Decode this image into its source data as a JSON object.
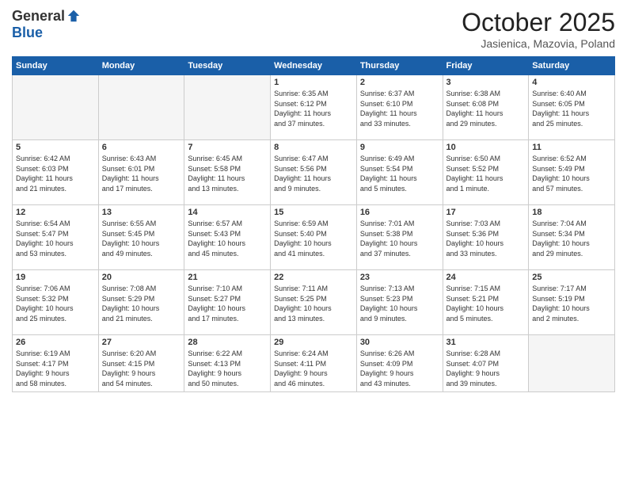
{
  "logo": {
    "general": "General",
    "blue": "Blue"
  },
  "header": {
    "month": "October 2025",
    "location": "Jasienica, Mazovia, Poland"
  },
  "weekdays": [
    "Sunday",
    "Monday",
    "Tuesday",
    "Wednesday",
    "Thursday",
    "Friday",
    "Saturday"
  ],
  "weeks": [
    [
      {
        "day": "",
        "info": ""
      },
      {
        "day": "",
        "info": ""
      },
      {
        "day": "",
        "info": ""
      },
      {
        "day": "1",
        "info": "Sunrise: 6:35 AM\nSunset: 6:12 PM\nDaylight: 11 hours\nand 37 minutes."
      },
      {
        "day": "2",
        "info": "Sunrise: 6:37 AM\nSunset: 6:10 PM\nDaylight: 11 hours\nand 33 minutes."
      },
      {
        "day": "3",
        "info": "Sunrise: 6:38 AM\nSunset: 6:08 PM\nDaylight: 11 hours\nand 29 minutes."
      },
      {
        "day": "4",
        "info": "Sunrise: 6:40 AM\nSunset: 6:05 PM\nDaylight: 11 hours\nand 25 minutes."
      }
    ],
    [
      {
        "day": "5",
        "info": "Sunrise: 6:42 AM\nSunset: 6:03 PM\nDaylight: 11 hours\nand 21 minutes."
      },
      {
        "day": "6",
        "info": "Sunrise: 6:43 AM\nSunset: 6:01 PM\nDaylight: 11 hours\nand 17 minutes."
      },
      {
        "day": "7",
        "info": "Sunrise: 6:45 AM\nSunset: 5:58 PM\nDaylight: 11 hours\nand 13 minutes."
      },
      {
        "day": "8",
        "info": "Sunrise: 6:47 AM\nSunset: 5:56 PM\nDaylight: 11 hours\nand 9 minutes."
      },
      {
        "day": "9",
        "info": "Sunrise: 6:49 AM\nSunset: 5:54 PM\nDaylight: 11 hours\nand 5 minutes."
      },
      {
        "day": "10",
        "info": "Sunrise: 6:50 AM\nSunset: 5:52 PM\nDaylight: 11 hours\nand 1 minute."
      },
      {
        "day": "11",
        "info": "Sunrise: 6:52 AM\nSunset: 5:49 PM\nDaylight: 10 hours\nand 57 minutes."
      }
    ],
    [
      {
        "day": "12",
        "info": "Sunrise: 6:54 AM\nSunset: 5:47 PM\nDaylight: 10 hours\nand 53 minutes."
      },
      {
        "day": "13",
        "info": "Sunrise: 6:55 AM\nSunset: 5:45 PM\nDaylight: 10 hours\nand 49 minutes."
      },
      {
        "day": "14",
        "info": "Sunrise: 6:57 AM\nSunset: 5:43 PM\nDaylight: 10 hours\nand 45 minutes."
      },
      {
        "day": "15",
        "info": "Sunrise: 6:59 AM\nSunset: 5:40 PM\nDaylight: 10 hours\nand 41 minutes."
      },
      {
        "day": "16",
        "info": "Sunrise: 7:01 AM\nSunset: 5:38 PM\nDaylight: 10 hours\nand 37 minutes."
      },
      {
        "day": "17",
        "info": "Sunrise: 7:03 AM\nSunset: 5:36 PM\nDaylight: 10 hours\nand 33 minutes."
      },
      {
        "day": "18",
        "info": "Sunrise: 7:04 AM\nSunset: 5:34 PM\nDaylight: 10 hours\nand 29 minutes."
      }
    ],
    [
      {
        "day": "19",
        "info": "Sunrise: 7:06 AM\nSunset: 5:32 PM\nDaylight: 10 hours\nand 25 minutes."
      },
      {
        "day": "20",
        "info": "Sunrise: 7:08 AM\nSunset: 5:29 PM\nDaylight: 10 hours\nand 21 minutes."
      },
      {
        "day": "21",
        "info": "Sunrise: 7:10 AM\nSunset: 5:27 PM\nDaylight: 10 hours\nand 17 minutes."
      },
      {
        "day": "22",
        "info": "Sunrise: 7:11 AM\nSunset: 5:25 PM\nDaylight: 10 hours\nand 13 minutes."
      },
      {
        "day": "23",
        "info": "Sunrise: 7:13 AM\nSunset: 5:23 PM\nDaylight: 10 hours\nand 9 minutes."
      },
      {
        "day": "24",
        "info": "Sunrise: 7:15 AM\nSunset: 5:21 PM\nDaylight: 10 hours\nand 5 minutes."
      },
      {
        "day": "25",
        "info": "Sunrise: 7:17 AM\nSunset: 5:19 PM\nDaylight: 10 hours\nand 2 minutes."
      }
    ],
    [
      {
        "day": "26",
        "info": "Sunrise: 6:19 AM\nSunset: 4:17 PM\nDaylight: 9 hours\nand 58 minutes."
      },
      {
        "day": "27",
        "info": "Sunrise: 6:20 AM\nSunset: 4:15 PM\nDaylight: 9 hours\nand 54 minutes."
      },
      {
        "day": "28",
        "info": "Sunrise: 6:22 AM\nSunset: 4:13 PM\nDaylight: 9 hours\nand 50 minutes."
      },
      {
        "day": "29",
        "info": "Sunrise: 6:24 AM\nSunset: 4:11 PM\nDaylight: 9 hours\nand 46 minutes."
      },
      {
        "day": "30",
        "info": "Sunrise: 6:26 AM\nSunset: 4:09 PM\nDaylight: 9 hours\nand 43 minutes."
      },
      {
        "day": "31",
        "info": "Sunrise: 6:28 AM\nSunset: 4:07 PM\nDaylight: 9 hours\nand 39 minutes."
      },
      {
        "day": "",
        "info": ""
      }
    ]
  ]
}
